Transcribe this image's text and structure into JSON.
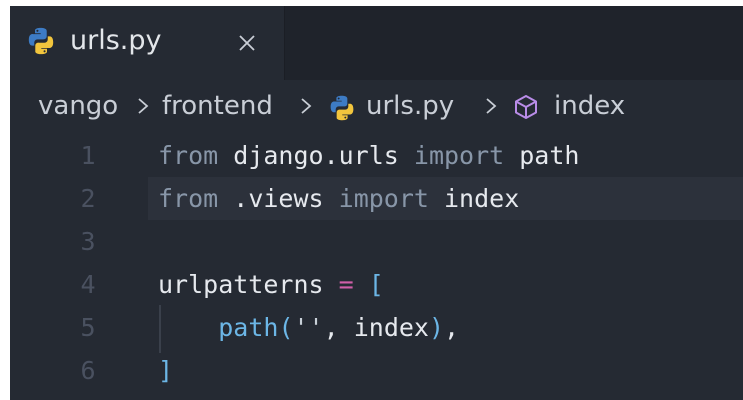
{
  "tab": {
    "filename": "urls.py",
    "icon": "python-icon",
    "close_icon": "close-icon"
  },
  "breadcrumb": {
    "items": [
      {
        "label": "vango"
      },
      {
        "label": "frontend"
      },
      {
        "label": "urls.py",
        "icon": "python-icon"
      },
      {
        "label": "index",
        "icon": "symbol-cube-icon"
      }
    ],
    "separator": "chevron-right-icon"
  },
  "editor": {
    "lines": [
      {
        "number": "1",
        "tokens": [
          {
            "t": "from",
            "k": "kw"
          },
          {
            "t": " django.urls ",
            "k": "id"
          },
          {
            "t": "import",
            "k": "kw"
          },
          {
            "t": " path",
            "k": "id"
          }
        ]
      },
      {
        "number": "2",
        "tokens": [
          {
            "t": "from",
            "k": "kw"
          },
          {
            "t": " .views ",
            "k": "id"
          },
          {
            "t": "import",
            "k": "kw"
          },
          {
            "t": " index",
            "k": "id"
          }
        ]
      },
      {
        "number": "3",
        "tokens": []
      },
      {
        "number": "4",
        "tokens": [
          {
            "t": "urlpatterns ",
            "k": "id"
          },
          {
            "t": "=",
            "k": "op"
          },
          {
            "t": " ",
            "k": "id"
          },
          {
            "t": "[",
            "k": "br"
          }
        ]
      },
      {
        "number": "5",
        "tokens": [
          {
            "t": "    ",
            "k": "id"
          },
          {
            "t": "path",
            "k": "fn"
          },
          {
            "t": "(",
            "k": "br"
          },
          {
            "t": "''",
            "k": "str"
          },
          {
            "t": ", index",
            "k": "id"
          },
          {
            "t": ")",
            "k": "br"
          },
          {
            "t": ",",
            "k": "punc"
          }
        ]
      },
      {
        "number": "6",
        "tokens": [
          {
            "t": "]",
            "k": "br"
          }
        ]
      }
    ],
    "current_line": "2"
  },
  "colors": {
    "editor_bg": "#252a33",
    "tabbar_bg": "#1f232b",
    "current_line_bg": "#2c313b",
    "keyword": "#8896a8",
    "identifier": "#e6e9ee",
    "operator": "#d05fa8",
    "bracket": "#6cb6e6",
    "line_number": "#4a5160",
    "symbol_icon": "#b98ce8"
  }
}
